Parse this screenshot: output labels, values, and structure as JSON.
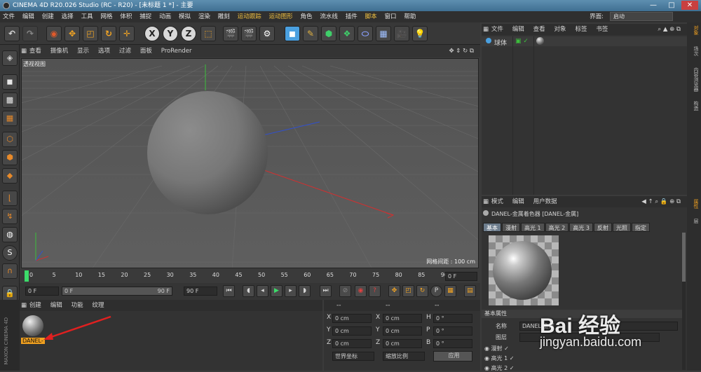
{
  "titlebar": {
    "title": "CINEMA 4D R20.026 Studio (RC - R20) - [未标题 1 *] - 主要",
    "min": "—",
    "max": "□",
    "close": "✕"
  },
  "menubar": {
    "items": [
      "文件",
      "编辑",
      "创建",
      "选择",
      "工具",
      "网格",
      "体积",
      "捕捉",
      "动画",
      "模拟",
      "渲染",
      "雕刻",
      "运动跟踪",
      "运动图形",
      "角色",
      "流水线",
      "插件",
      "脚本",
      "窗口",
      "帮助"
    ],
    "layout_label": "界面:",
    "layout_value": "启动"
  },
  "toolbar": {
    "x": "X",
    "y": "Y",
    "z": "Z"
  },
  "viewport": {
    "menu": [
      "查看",
      "摄像机",
      "显示",
      "选项",
      "过滤",
      "面板",
      "ProRender"
    ],
    "label": "透视视图",
    "grid_info": "网格间距 : 100 cm"
  },
  "timeline": {
    "ticks": [
      "0",
      "5",
      "10",
      "15",
      "20",
      "25",
      "30",
      "35",
      "40",
      "45",
      "50",
      "55",
      "60",
      "65",
      "70",
      "75",
      "80",
      "85",
      "90"
    ],
    "end_frame": "0 F"
  },
  "transport": {
    "start": "0 F",
    "range_start": "0 F",
    "range_end": "90 F",
    "end": "90 F"
  },
  "materials": {
    "menu": [
      "创建",
      "编辑",
      "功能",
      "纹理"
    ],
    "material_name": "DANEL-"
  },
  "coords": {
    "headers": [
      "--",
      "--",
      "--"
    ],
    "rows": [
      {
        "a": "X",
        "av": "0 cm",
        "b": "X",
        "bv": "0 cm",
        "c": "H",
        "cv": "0 °"
      },
      {
        "a": "Y",
        "av": "0 cm",
        "b": "Y",
        "bv": "0 cm",
        "c": "P",
        "cv": "0 °"
      },
      {
        "a": "Z",
        "av": "0 cm",
        "b": "Z",
        "bv": "0 cm",
        "c": "B",
        "cv": "0 °"
      }
    ],
    "world": "世界坐标",
    "scale": "缩放比例",
    "apply": "应用"
  },
  "objects": {
    "menu": [
      "文件",
      "编辑",
      "查看",
      "对象",
      "标签",
      "书签"
    ],
    "items": [
      {
        "name": "球体"
      }
    ]
  },
  "attributes": {
    "menu": [
      "模式",
      "编辑",
      "用户数据"
    ],
    "title": "DANEL-金属着色器 [DANEL-金属]",
    "tabs": [
      "基本",
      "漫射",
      "高光 1",
      "高光 2",
      "高光 3",
      "反射",
      "光照",
      "指定"
    ],
    "section": "基本属性",
    "name_label": "名称",
    "name_value": "DANEL-金属",
    "layer_label": "图层",
    "checks": [
      "漫射",
      "高光 1",
      "高光 2"
    ]
  },
  "rightstrip": {
    "tabs": [
      "对象",
      "场次",
      "内容浏览器",
      "构造",
      "属性",
      "层"
    ]
  },
  "watermark": {
    "brand": "Bai 经验",
    "url": "jingyan.baidu.com"
  }
}
